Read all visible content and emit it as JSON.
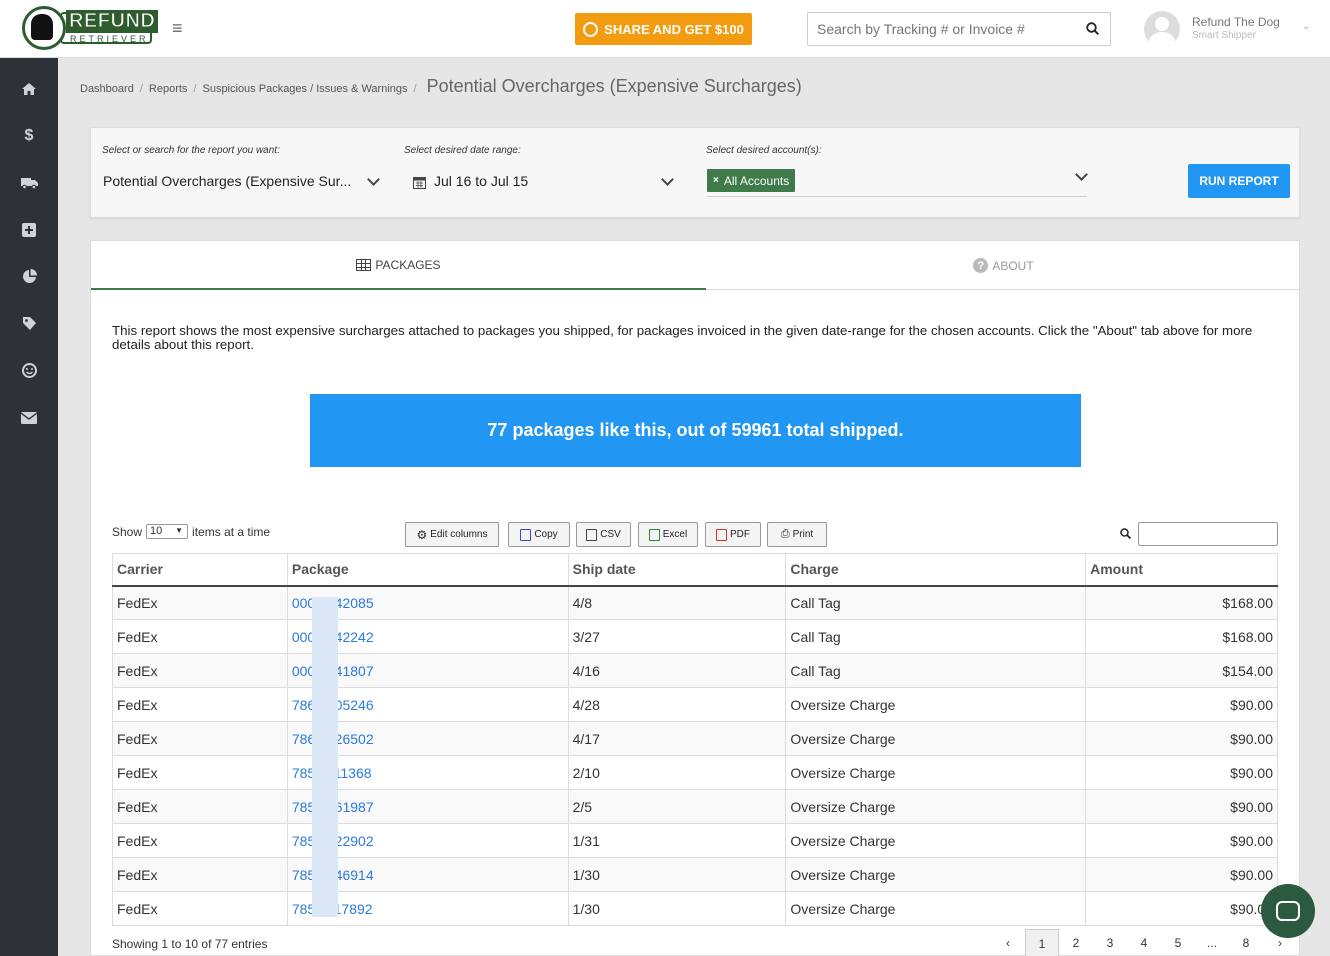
{
  "app": {
    "logo_top": "REFUND",
    "logo_bottom": "RETRIEVER"
  },
  "header": {
    "share_label": "SHARE AND GET $100",
    "search_placeholder": "Search by Tracking # or Invoice #",
    "user_name": "Refund The Dog",
    "user_role": "Smart Shipper"
  },
  "sidebar": {
    "items": [
      {
        "icon": "home-icon"
      },
      {
        "icon": "dollar-icon"
      },
      {
        "icon": "truck-icon"
      },
      {
        "icon": "plus-square-icon"
      },
      {
        "icon": "pie-chart-icon"
      },
      {
        "icon": "tag-icon"
      },
      {
        "icon": "smile-icon"
      },
      {
        "icon": "envelope-icon"
      }
    ]
  },
  "breadcrumb": {
    "items": [
      "Dashboard",
      "Reports",
      "Suspicious Packages / Issues & Warnings"
    ],
    "current": "Potential Overcharges (Expensive Surcharges)"
  },
  "filters": {
    "report_label": "Select or search for the report you want:",
    "report_value": "Potential Overcharges (Expensive Sur...",
    "date_label": "Select desired date range:",
    "date_value": "Jul 16 to Jul 15",
    "account_label": "Select desired account(s):",
    "account_tag": "All Accounts",
    "run_label": "RUN REPORT"
  },
  "tabs": {
    "packages": "PACKAGES",
    "about": "ABOUT"
  },
  "report": {
    "description": "This report shows the most expensive surcharges attached to packages you shipped, for packages invoiced in the given date-range for the chosen accounts. Click the \"About\" tab above for more details about this report.",
    "banner": "77 packages like this, out of 59961 total shipped."
  },
  "table_controls": {
    "show_prefix": "Show",
    "page_size": "10",
    "show_suffix": "items at a time",
    "edit_columns": "Edit columns",
    "copy": "Copy",
    "csv": "CSV",
    "excel": "Excel",
    "pdf": "PDF",
    "print": "Print"
  },
  "table": {
    "headers": [
      "Carrier",
      "Package",
      "Ship date",
      "Charge",
      "Amount"
    ],
    "rows": [
      {
        "carrier": "FedEx",
        "package": "000  0542085",
        "ship_date": "4/8",
        "charge": "Call Tag",
        "amount": "$168.00"
      },
      {
        "carrier": "FedEx",
        "package": "000  9142242",
        "ship_date": "3/27",
        "charge": "Call Tag",
        "amount": "$168.00"
      },
      {
        "carrier": "FedEx",
        "package": "000  1241807",
        "ship_date": "4/16",
        "charge": "Call Tag",
        "amount": "$154.00"
      },
      {
        "carrier": "FedEx",
        "package": "786  9605246",
        "ship_date": "4/28",
        "charge": "Oversize Charge",
        "amount": "$90.00"
      },
      {
        "carrier": "FedEx",
        "package": "786  9926502",
        "ship_date": "4/17",
        "charge": "Oversize Charge",
        "amount": "$90.00"
      },
      {
        "carrier": "FedEx",
        "package": "785  2111368",
        "ship_date": "2/10",
        "charge": "Oversize Charge",
        "amount": "$90.00"
      },
      {
        "carrier": "FedEx",
        "package": "785  5061987",
        "ship_date": "2/5",
        "charge": "Oversize Charge",
        "amount": "$90.00"
      },
      {
        "carrier": "FedEx",
        "package": "785  2022902",
        "ship_date": "1/31",
        "charge": "Oversize Charge",
        "amount": "$90.00"
      },
      {
        "carrier": "FedEx",
        "package": "785  9146914",
        "ship_date": "1/30",
        "charge": "Oversize Charge",
        "amount": "$90.00"
      },
      {
        "carrier": "FedEx",
        "package": "785  9117892",
        "ship_date": "1/30",
        "charge": "Oversize Charge",
        "amount": "$90.00"
      }
    ]
  },
  "footer": {
    "showing": "Showing 1 to 10 of 77 entries",
    "pages": [
      "‹",
      "1",
      "2",
      "3",
      "4",
      "5",
      "...",
      "8",
      "›"
    ],
    "active_page": "1"
  },
  "colors": {
    "accent_green": "#3e7a4a",
    "primary_blue": "#2196f3",
    "share_orange": "#f39c12",
    "sidebar_bg": "#2c3238"
  }
}
